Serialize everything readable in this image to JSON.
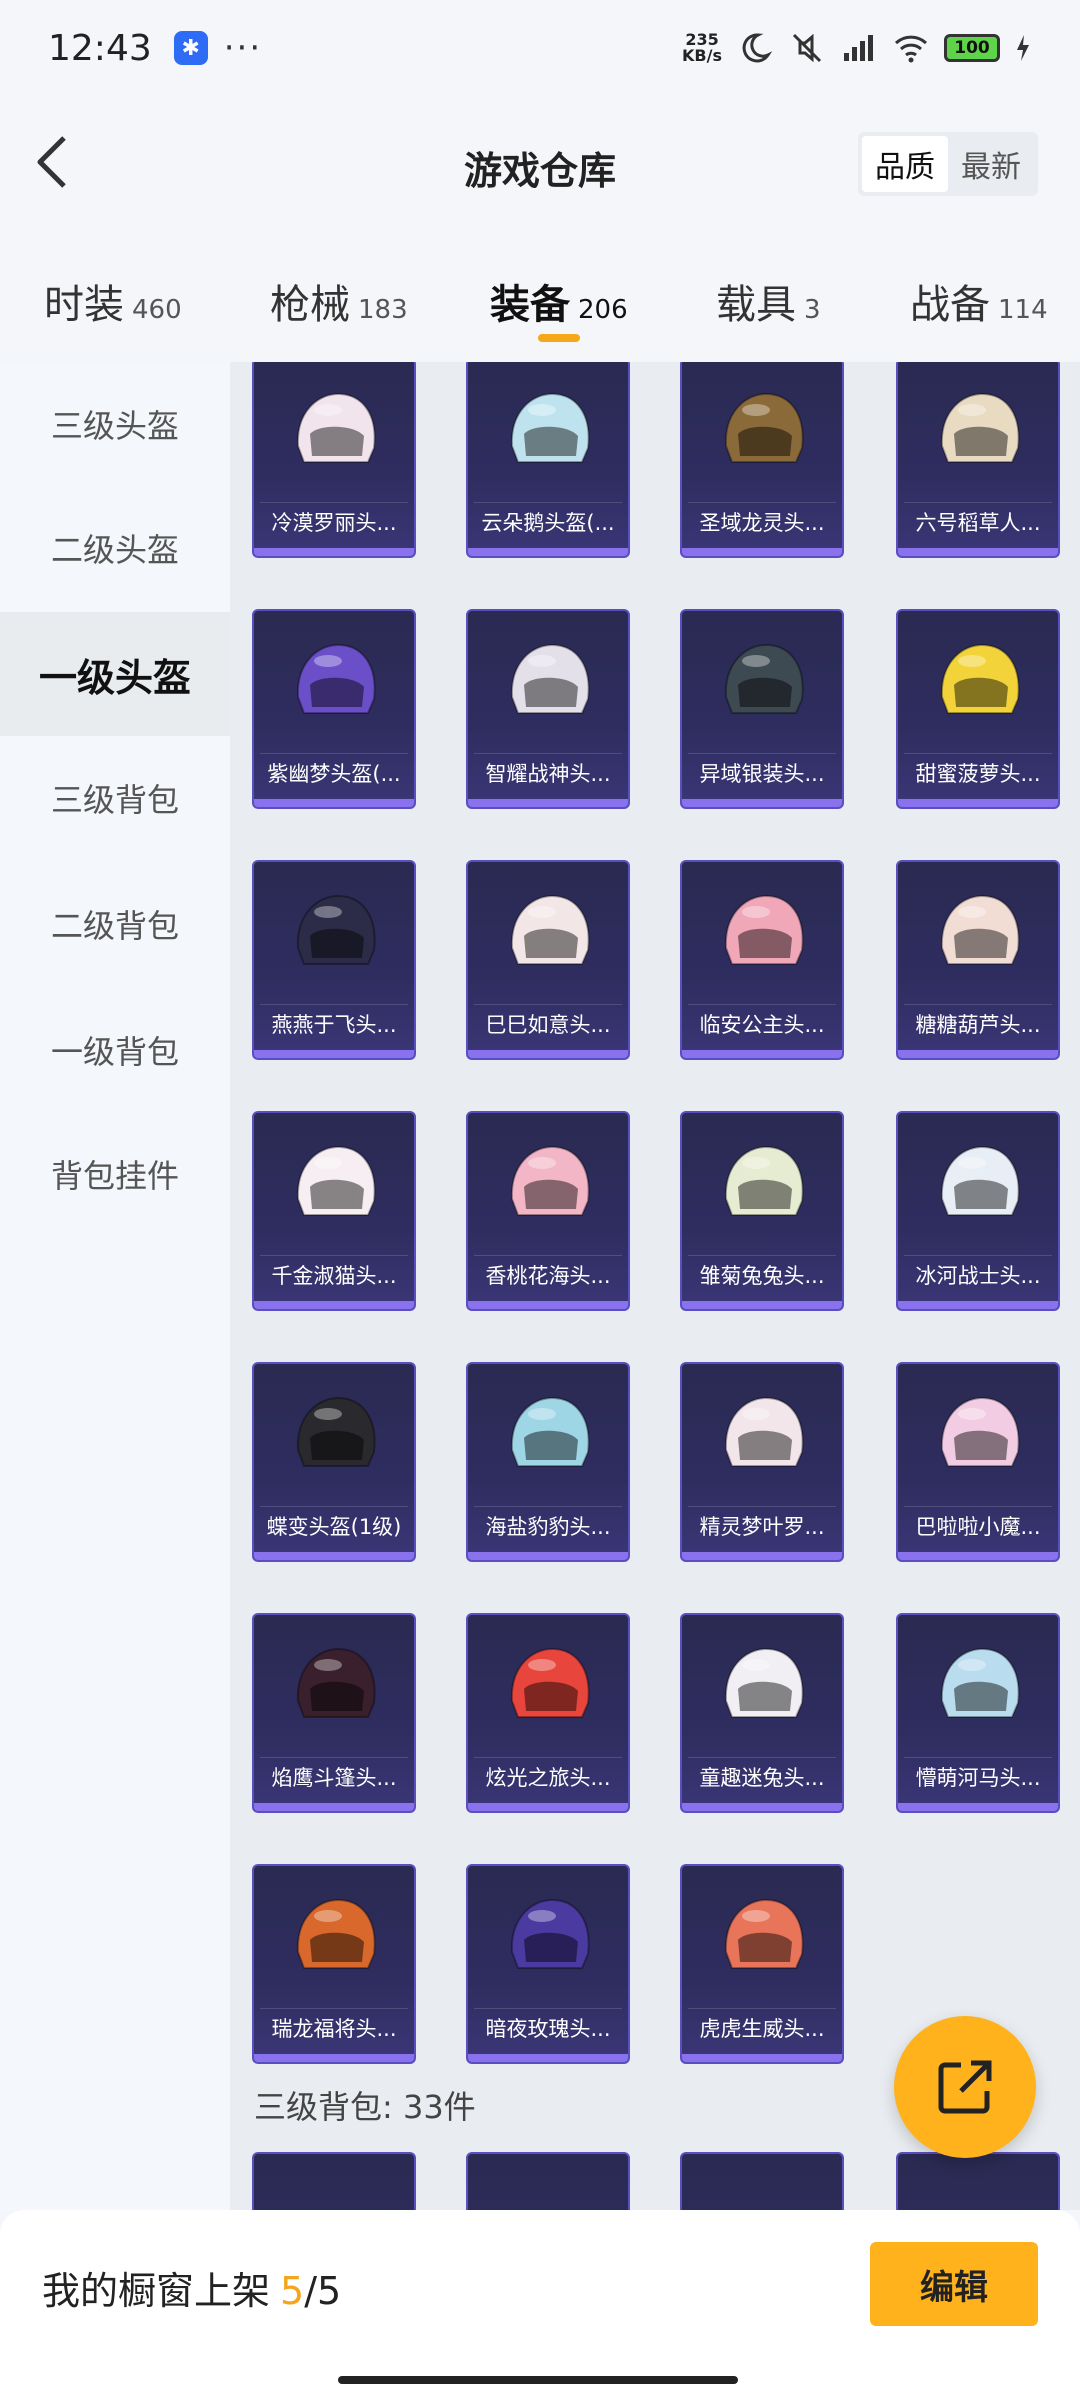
{
  "status": {
    "time": "12:43",
    "speed_top": "235",
    "speed_bottom": "KB/s",
    "battery": "100"
  },
  "header": {
    "title": "游戏仓库",
    "sort_options": [
      "品质",
      "最新"
    ]
  },
  "tabs": [
    {
      "label": "时装",
      "count": "460"
    },
    {
      "label": "枪械",
      "count": "183"
    },
    {
      "label": "装备",
      "count": "206"
    },
    {
      "label": "载具",
      "count": "3"
    },
    {
      "label": "战备",
      "count": "114"
    }
  ],
  "sidebar": {
    "items": [
      "三级头盔",
      "二级头盔",
      "一级头盔",
      "三级背包",
      "二级背包",
      "一级背包",
      "背包挂件"
    ]
  },
  "items": [
    {
      "name": "冷漠罗丽头...",
      "color": "#f1e4ec"
    },
    {
      "name": "云朵鹅头盔(...",
      "color": "#bfe3ee"
    },
    {
      "name": "圣域龙灵头...",
      "color": "#8b6a3a"
    },
    {
      "name": "六号稻草人...",
      "color": "#e9dbc2"
    },
    {
      "name": "紫幽梦头盔(...",
      "color": "#6b4fc9"
    },
    {
      "name": "智耀战神头...",
      "color": "#e4e0ea"
    },
    {
      "name": "异域银装头...",
      "color": "#3e4a52"
    },
    {
      "name": "甜蜜菠萝头...",
      "color": "#f2d43a"
    },
    {
      "name": "燕燕于飞头...",
      "color": "#2d2c48"
    },
    {
      "name": "巳巳如意头...",
      "color": "#f3e6e6"
    },
    {
      "name": "临安公主头...",
      "color": "#f0a7b8"
    },
    {
      "name": "糖糖葫芦头...",
      "color": "#f1ddd4"
    },
    {
      "name": "千金淑猫头...",
      "color": "#f6eef2"
    },
    {
      "name": "香桃花海头...",
      "color": "#f2b6c6"
    },
    {
      "name": "雏菊兔兔头...",
      "color": "#e6ecd2"
    },
    {
      "name": "冰河战士头...",
      "color": "#e8eef6"
    },
    {
      "name": "蝶变头盔(1级)",
      "color": "#2a2a2e"
    },
    {
      "name": "海盐豹豹头...",
      "color": "#9fd6e6"
    },
    {
      "name": "精灵梦叶罗...",
      "color": "#f2e6ea"
    },
    {
      "name": "巴啦啦小魔...",
      "color": "#f1cce2"
    },
    {
      "name": "焰鹰斗篷头...",
      "color": "#3a1f2c"
    },
    {
      "name": "炫光之旅头...",
      "color": "#e8453c"
    },
    {
      "name": "童趣迷兔头...",
      "color": "#f1eef4"
    },
    {
      "name": "懵萌河马头...",
      "color": "#b9dcef"
    },
    {
      "name": "瑞龙福将头...",
      "color": "#d8682c"
    },
    {
      "name": "暗夜玫瑰头...",
      "color": "#4b3aa0"
    },
    {
      "name": "虎虎生威头...",
      "color": "#e8745a"
    }
  ],
  "section": {
    "label": "三级背包: 33件"
  },
  "bottom": {
    "prefix": "我的橱窗上架",
    "count": "5",
    "total": "/5",
    "edit_label": "编辑"
  }
}
